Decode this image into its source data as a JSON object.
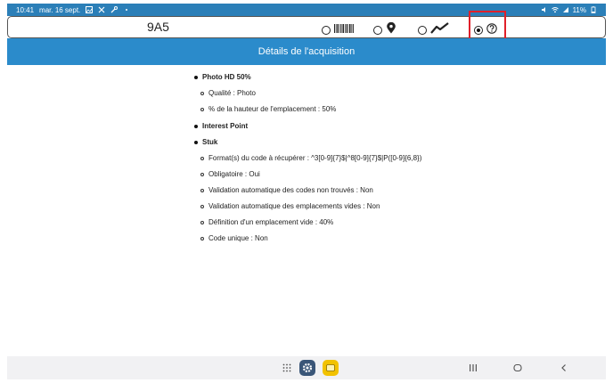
{
  "status_bar": {
    "time": "10:41",
    "date": "mar. 16 sept.",
    "battery": "11%"
  },
  "toolbar": {
    "code": "9A5",
    "options": [
      {
        "name": "barcode",
        "icon": "barcode-icon",
        "selected": false
      },
      {
        "name": "location",
        "icon": "location-pin-icon",
        "selected": false
      },
      {
        "name": "trend",
        "icon": "trend-line-icon",
        "selected": false
      },
      {
        "name": "help",
        "icon": "help-icon",
        "selected": true
      }
    ]
  },
  "header": {
    "title": "Détails de l'acquisition"
  },
  "details": {
    "photo": {
      "title": "Photo HD 50%",
      "items": [
        "Qualité : Photo",
        "% de la hauteur de l'emplacement : 50%"
      ]
    },
    "interest": {
      "title": "Interest Point"
    },
    "stuk": {
      "title": "Stuk",
      "items": [
        "Format(s) du code à récupérer : ^3[0-9]{7}$|^8[0-9]{7}$|P([0-9]{6,8})",
        "Obligatoire : Oui",
        "Validation automatique des codes non trouvés : Non",
        "Validation automatique des emplacements vides : Non",
        "Définition d'un emplacement vide : 40%",
        "Code unique : Non"
      ]
    }
  },
  "colors": {
    "header_blue": "#2b8bcb",
    "status_blue": "#2b7fb8",
    "highlight_red": "#e0202a"
  }
}
